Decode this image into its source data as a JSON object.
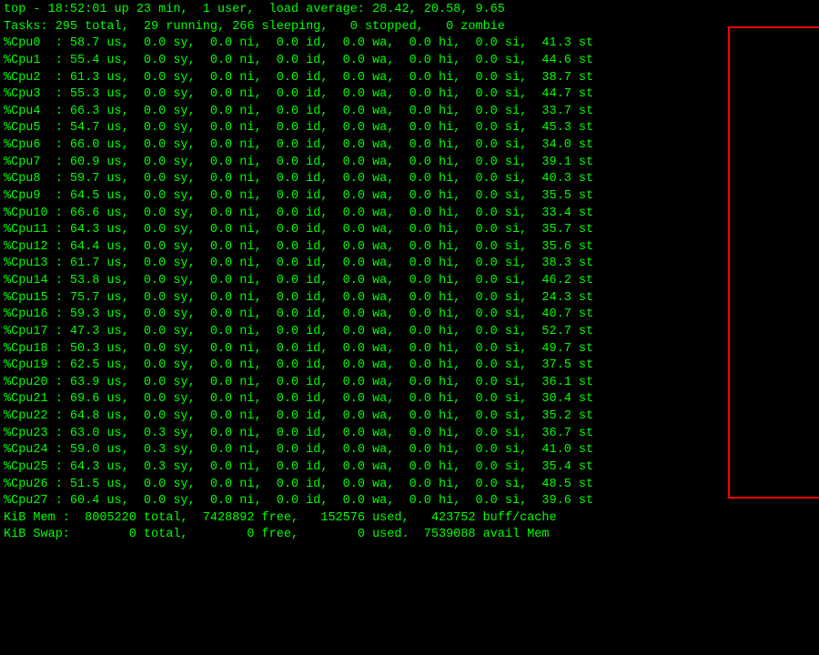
{
  "terminal": {
    "header_line1": "top - 18:52:01 up 23 min,  1 user,  load average: 28.42, 20.58, 9.65",
    "header_line2": "Tasks: 295 total,  29 running, 266 sleeping,   0 stopped,   0 zombie",
    "cpus": [
      {
        "name": "%Cpu0 ",
        "us": "58.7",
        "sy": "0.0",
        "ni": "0.0",
        "id": "0.0",
        "wa": "0.0",
        "hi": "0.0",
        "si": "0.0",
        "st": "41.3"
      },
      {
        "name": "%Cpu1 ",
        "us": "55.4",
        "sy": "0.0",
        "ni": "0.0",
        "id": "0.0",
        "wa": "0.0",
        "hi": "0.0",
        "si": "0.0",
        "st": "44.6"
      },
      {
        "name": "%Cpu2 ",
        "us": "61.3",
        "sy": "0.0",
        "ni": "0.0",
        "id": "0.0",
        "wa": "0.0",
        "hi": "0.0",
        "si": "0.0",
        "st": "38.7"
      },
      {
        "name": "%Cpu3 ",
        "us": "55.3",
        "sy": "0.0",
        "ni": "0.0",
        "id": "0.0",
        "wa": "0.0",
        "hi": "0.0",
        "si": "0.0",
        "st": "44.7"
      },
      {
        "name": "%Cpu4 ",
        "us": "66.3",
        "sy": "0.0",
        "ni": "0.0",
        "id": "0.0",
        "wa": "0.0",
        "hi": "0.0",
        "si": "0.0",
        "st": "33.7"
      },
      {
        "name": "%Cpu5 ",
        "us": "54.7",
        "sy": "0.0",
        "ni": "0.0",
        "id": "0.0",
        "wa": "0.0",
        "hi": "0.0",
        "si": "0.0",
        "st": "45.3"
      },
      {
        "name": "%Cpu6 ",
        "us": "66.0",
        "sy": "0.0",
        "ni": "0.0",
        "id": "0.0",
        "wa": "0.0",
        "hi": "0.0",
        "si": "0.0",
        "st": "34.0"
      },
      {
        "name": "%Cpu7 ",
        "us": "60.9",
        "sy": "0.0",
        "ni": "0.0",
        "id": "0.0",
        "wa": "0.0",
        "hi": "0.0",
        "si": "0.0",
        "st": "39.1"
      },
      {
        "name": "%Cpu8 ",
        "us": "59.7",
        "sy": "0.0",
        "ni": "0.0",
        "id": "0.0",
        "wa": "0.0",
        "hi": "0.0",
        "si": "0.0",
        "st": "40.3"
      },
      {
        "name": "%Cpu9 ",
        "us": "64.5",
        "sy": "0.0",
        "ni": "0.0",
        "id": "0.0",
        "wa": "0.0",
        "hi": "0.0",
        "si": "0.0",
        "st": "35.5"
      },
      {
        "name": "%Cpu10",
        "us": "66.6",
        "sy": "0.0",
        "ni": "0.0",
        "id": "0.0",
        "wa": "0.0",
        "hi": "0.0",
        "si": "0.0",
        "st": "33.4"
      },
      {
        "name": "%Cpu11",
        "us": "64.3",
        "sy": "0.0",
        "ni": "0.0",
        "id": "0.0",
        "wa": "0.0",
        "hi": "0.0",
        "si": "0.0",
        "st": "35.7"
      },
      {
        "name": "%Cpu12",
        "us": "64.4",
        "sy": "0.0",
        "ni": "0.0",
        "id": "0.0",
        "wa": "0.0",
        "hi": "0.0",
        "si": "0.0",
        "st": "35.6"
      },
      {
        "name": "%Cpu13",
        "us": "61.7",
        "sy": "0.0",
        "ni": "0.0",
        "id": "0.0",
        "wa": "0.0",
        "hi": "0.0",
        "si": "0.0",
        "st": "38.3"
      },
      {
        "name": "%Cpu14",
        "us": "53.8",
        "sy": "0.0",
        "ni": "0.0",
        "id": "0.0",
        "wa": "0.0",
        "hi": "0.0",
        "si": "0.0",
        "st": "46.2"
      },
      {
        "name": "%Cpu15",
        "us": "75.7",
        "sy": "0.0",
        "ni": "0.0",
        "id": "0.0",
        "wa": "0.0",
        "hi": "0.0",
        "si": "0.0",
        "st": "24.3"
      },
      {
        "name": "%Cpu16",
        "us": "59.3",
        "sy": "0.0",
        "ni": "0.0",
        "id": "0.0",
        "wa": "0.0",
        "hi": "0.0",
        "si": "0.0",
        "st": "40.7"
      },
      {
        "name": "%Cpu17",
        "us": "47.3",
        "sy": "0.0",
        "ni": "0.0",
        "id": "0.0",
        "wa": "0.0",
        "hi": "0.0",
        "si": "0.0",
        "st": "52.7"
      },
      {
        "name": "%Cpu18",
        "us": "50.3",
        "sy": "0.0",
        "ni": "0.0",
        "id": "0.0",
        "wa": "0.0",
        "hi": "0.0",
        "si": "0.0",
        "st": "49.7"
      },
      {
        "name": "%Cpu19",
        "us": "62.5",
        "sy": "0.0",
        "ni": "0.0",
        "id": "0.0",
        "wa": "0.0",
        "hi": "0.0",
        "si": "0.0",
        "st": "37.5"
      },
      {
        "name": "%Cpu20",
        "us": "63.9",
        "sy": "0.0",
        "ni": "0.0",
        "id": "0.0",
        "wa": "0.0",
        "hi": "0.0",
        "si": "0.0",
        "st": "36.1"
      },
      {
        "name": "%Cpu21",
        "us": "69.6",
        "sy": "0.0",
        "ni": "0.0",
        "id": "0.0",
        "wa": "0.0",
        "hi": "0.0",
        "si": "0.0",
        "st": "30.4"
      },
      {
        "name": "%Cpu22",
        "us": "64.8",
        "sy": "0.0",
        "ni": "0.0",
        "id": "0.0",
        "wa": "0.0",
        "hi": "0.0",
        "si": "0.0",
        "st": "35.2"
      },
      {
        "name": "%Cpu23",
        "us": "63.0",
        "sy": "0.3",
        "ni": "0.0",
        "id": "0.0",
        "wa": "0.0",
        "hi": "0.0",
        "si": "0.0",
        "st": "36.7"
      },
      {
        "name": "%Cpu24",
        "us": "59.0",
        "sy": "0.3",
        "ni": "0.0",
        "id": "0.0",
        "wa": "0.0",
        "hi": "0.0",
        "si": "0.0",
        "st": "41.0"
      },
      {
        "name": "%Cpu25",
        "us": "64.3",
        "sy": "0.3",
        "ni": "0.0",
        "id": "0.0",
        "wa": "0.0",
        "hi": "0.0",
        "si": "0.0",
        "st": "35.4"
      },
      {
        "name": "%Cpu26",
        "us": "51.5",
        "sy": "0.0",
        "ni": "0.0",
        "id": "0.0",
        "wa": "0.0",
        "hi": "0.0",
        "si": "0.0",
        "st": "48.5"
      },
      {
        "name": "%Cpu27",
        "us": "60.4",
        "sy": "0.0",
        "ni": "0.0",
        "id": "0.0",
        "wa": "0.0",
        "hi": "0.0",
        "si": "0.0",
        "st": "39.6"
      }
    ],
    "mem_line": "KiB Mem :  8005220 total,  7428892 free,   152576 used,   423752 buff/cache",
    "swap_line": "KiB Swap:        0 total,        0 free,        0 used.  7539088 avail Mem"
  }
}
